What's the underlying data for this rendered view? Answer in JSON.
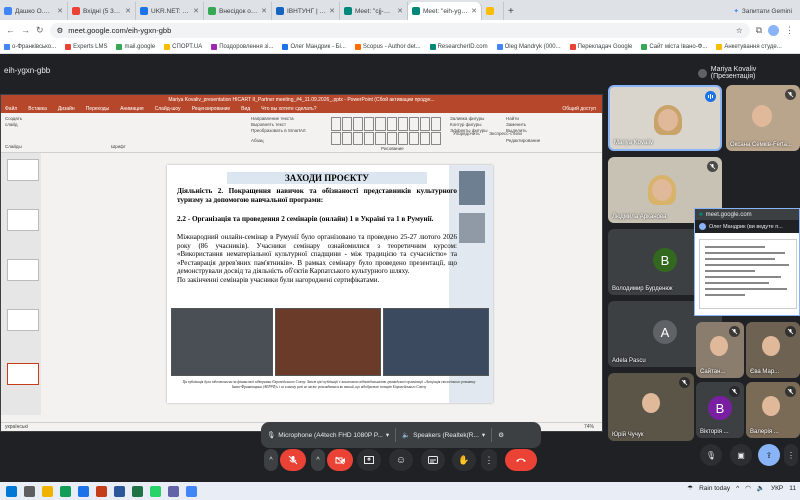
{
  "browser": {
    "tabs": [
      {
        "label": "Дашко О.М. - Google А",
        "color": "#4285f4"
      },
      {
        "label": "Вхідні (5 397) - oleh.mand",
        "color": "#ea4335"
      },
      {
        "label": "UKR.NET: Всі новини Укр",
        "color": "#1a73e8"
      },
      {
        "label": "Внесідок обміняно До",
        "color": "#34a853"
      },
      {
        "label": "ІВНТУНГ | Івано-Франків",
        "color": "#1565c0"
      },
      {
        "label": "Meet: \"cjj-mfic-epf\"",
        "color": "#00897b"
      },
      {
        "label": "Meet: \"eih-ygxn-gbb\"",
        "color": "#00897b",
        "active": true
      },
      {
        "label": "",
        "color": "#fbbc04"
      }
    ],
    "gemini": "Запитати Gemini",
    "url": "meet.google.com/eih-ygxn-gbb",
    "bookmarks": [
      "о-Франківсько...",
      "Experts LMS",
      "mail.google",
      "СПОРТ.UA",
      "Поздоровлення зі...",
      "Олег Мандрик - Бі...",
      "Scopus - Author det...",
      "ResearcherID.com",
      "Oleg Mandryk (000...",
      "Перекладач Google",
      "Сайт міста Івано-Ф...",
      "Анкетування студе..."
    ]
  },
  "meet": {
    "name": "eih-ygxn-gbb",
    "presenter": "Mariya Kovaliv (Презентація)"
  },
  "ppt": {
    "titlebar": "Mariya Kovaliv_presentation HICART II_Partner meeting_#4_11.09.2026_.pptx - PowerPoint (Сбой активации продук...",
    "menu": [
      "Файл",
      "Вставка",
      "Дизайн",
      "Переходы",
      "Анимация",
      "Слайд-шоу",
      "Рецензирование",
      "Вид",
      "Что вы хотите сделать?"
    ],
    "share": "Общий доступ",
    "ribbon_left": [
      "Создать",
      "слайд"
    ],
    "ribbon_groups": [
      "Слайды",
      "Шрифт",
      "Абзац",
      "Рисование",
      "Редактирование"
    ],
    "ribbon_cmds": [
      "Направление текста",
      "Выровнять текст",
      "Преобразовать в SmartArt"
    ],
    "ribbon_right": [
      "Заливка фигуры",
      "Контур фигуры",
      "Эффекты фигуры",
      "Найти",
      "Заменить",
      "Выделить"
    ],
    "arrange": "Упорядочить",
    "styles": "Экспресс-стили",
    "status_left": "українські",
    "zoom": "74%"
  },
  "slide": {
    "title": "ЗАХОДИ ПРОЄКТУ",
    "h1": "Діяльність 2. Покращення навичок та обізнаності представників культурного туризму за допомогою навчальної програми:",
    "h2": "2.2 - Організація та проведення 2 семінарів (онлайн) 1 в Україні та 1 в Румунії.",
    "body": "Міжнародний онлайн-семінар в Румунії було організовано та проведено 25-27 лютого 2026 року (86 учасників). Учасники семінару ознайомилися з теоретичним курсом: «Використання нематеріальної культурної спадщини - між традицією та сучасністю» та «Реставрація дерев'яних пам'ятників». В рамках семінару було проведено презентації, що демонстрували досвід та діяльність об'єктів Карпатського культурного шляху.",
    "body2": "По закінченні семінарів учасники були нагороджені сертифікатами.",
    "caption": "Ця публікація була підготовлена за фінансової підтримки Європейського Союзу. Зміст цієї публікації є виключною відповідальністю громадської організації «Асоціація екологічного розвитку Івано-Франківщини (АЕРУФ)» і ні в якому разі не може розглядатися як такий, що відображає позицію Європейського Союзу"
  },
  "participants": [
    {
      "name": "Mariya Kovaliv",
      "muted": false,
      "speaking": true
    },
    {
      "name": "Оксана Семків-Ferta...",
      "muted": true
    },
    {
      "name": "Людмила Арканова",
      "muted": true
    },
    {
      "name": "Володимир Бурденюк",
      "letter": "В",
      "color": "#33691e",
      "muted": true
    },
    {
      "name": "Adela Pascu",
      "letter": "A",
      "color": "#5f6368",
      "muted": true
    },
    {
      "name": "Сайтан...",
      "muted": true
    },
    {
      "name": "Єва Мар...",
      "muted": true
    },
    {
      "name": "Юрій Чучук",
      "muted": true
    },
    {
      "name": "Вікторія ...",
      "letter": "В",
      "color": "#7b1fa2",
      "muted": true
    },
    {
      "name": "Валерія ...",
      "muted": true
    }
  ],
  "popup": {
    "url": "meet.google.com",
    "user": "Олег Мандрик (ви ведуте п..."
  },
  "controls": {
    "microphone": "Microphone (A4tech FHD 1080P P...",
    "speakers": "Speakers (Realtek(R..."
  },
  "taskbar": {
    "weather": "Rain today",
    "lang": "УКР",
    "time": "11"
  },
  "colors": {
    "meet_bg": "#202124",
    "ppt_accent": "#b7472a",
    "end_call": "#ea4335"
  }
}
